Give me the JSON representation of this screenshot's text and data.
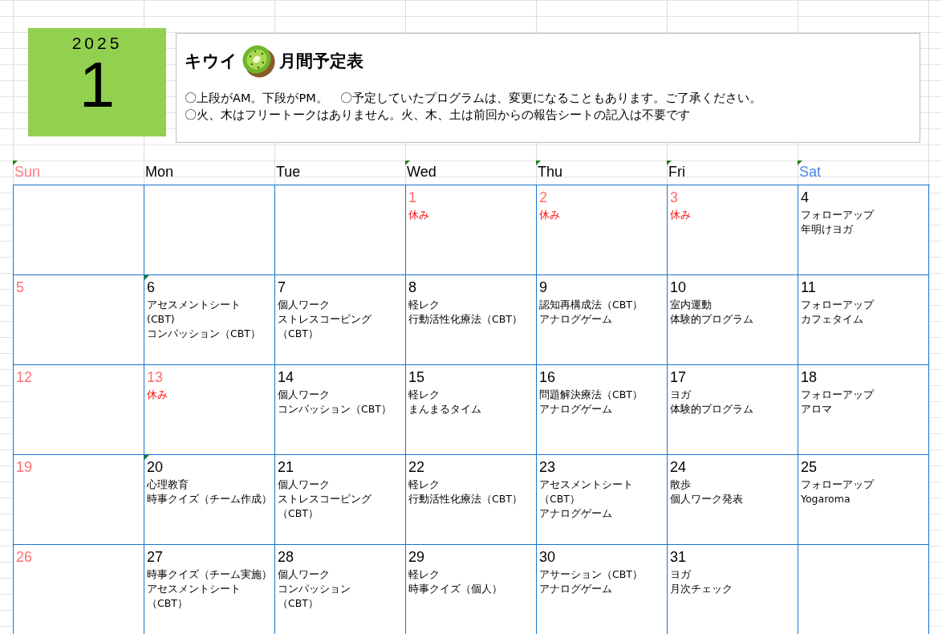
{
  "header": {
    "year": "2025",
    "month": "1",
    "title_before": "キウイ",
    "title_after": "月間予定表",
    "notes": [
      "〇上段がAM。下段がPM。　〇予定していたプログラムは、変更になることもあります。ご了承ください。",
      "〇火、木はフリートークはありません。火、木、土は前回からの報告シートの記入は不要です"
    ]
  },
  "weekdays": [
    {
      "label": "Sun",
      "color": "#ff7c80",
      "flagged": true
    },
    {
      "label": "Mon",
      "color": "#000000",
      "flagged": false
    },
    {
      "label": "Tue",
      "color": "#000000",
      "flagged": false
    },
    {
      "label": "Wed",
      "color": "#000000",
      "flagged": true
    },
    {
      "label": "Thu",
      "color": "#000000",
      "flagged": true
    },
    {
      "label": "Fri",
      "color": "#000000",
      "flagged": true
    },
    {
      "label": "Sat",
      "color": "#4a86e8",
      "flagged": true
    }
  ],
  "weeks": [
    [
      {
        "kind": "empty"
      },
      {
        "kind": "empty"
      },
      {
        "kind": "empty"
      },
      {
        "kind": "day",
        "day": "1",
        "holiday": true,
        "flagged": false,
        "lines": [
          "休み"
        ]
      },
      {
        "kind": "day",
        "day": "2",
        "holiday": true,
        "flagged": false,
        "lines": [
          "休み"
        ]
      },
      {
        "kind": "day",
        "day": "3",
        "holiday": true,
        "flagged": false,
        "lines": [
          "休み"
        ]
      },
      {
        "kind": "day",
        "day": "4",
        "holiday": false,
        "flagged": false,
        "lines": [
          "フォローアップ",
          "年明けヨガ"
        ]
      }
    ],
    [
      {
        "kind": "day",
        "day": "5",
        "holiday": true,
        "flagged": false
      },
      {
        "kind": "day",
        "day": "6",
        "holiday": false,
        "flagged": true,
        "lines": [
          "アセスメントシート",
          "(CBT)",
          "コンパッション（CBT）"
        ]
      },
      {
        "kind": "day",
        "day": "7",
        "holiday": false,
        "flagged": false,
        "lines": [
          "個人ワーク",
          "ストレスコーピング",
          "（CBT）"
        ]
      },
      {
        "kind": "day",
        "day": "8",
        "holiday": false,
        "flagged": false,
        "lines": [
          "軽レク",
          "行動活性化療法（CBT）"
        ]
      },
      {
        "kind": "day",
        "day": "9",
        "holiday": false,
        "flagged": false,
        "lines": [
          "認知再構成法（CBT）",
          "アナログゲーム"
        ]
      },
      {
        "kind": "day",
        "day": "10",
        "holiday": false,
        "flagged": false,
        "lines": [
          "室内運動",
          "体験的プログラム"
        ]
      },
      {
        "kind": "day",
        "day": "11",
        "holiday": false,
        "flagged": false,
        "lines": [
          "フォローアップ",
          "カフェタイム"
        ]
      }
    ],
    [
      {
        "kind": "day",
        "day": "12",
        "holiday": true,
        "flagged": false
      },
      {
        "kind": "day",
        "day": "13",
        "holiday": true,
        "flagged": false,
        "lines": [
          "休み"
        ]
      },
      {
        "kind": "day",
        "day": "14",
        "holiday": false,
        "flagged": false,
        "lines": [
          "個人ワーク",
          "コンパッション（CBT）"
        ]
      },
      {
        "kind": "day",
        "day": "15",
        "holiday": false,
        "flagged": false,
        "lines": [
          "軽レク",
          "まんまるタイム"
        ]
      },
      {
        "kind": "day",
        "day": "16",
        "holiday": false,
        "flagged": false,
        "lines": [
          "問題解決療法（CBT）",
          "アナログゲーム"
        ]
      },
      {
        "kind": "day",
        "day": "17",
        "holiday": false,
        "flagged": false,
        "lines": [
          "ヨガ",
          "体験的プログラム"
        ]
      },
      {
        "kind": "day",
        "day": "18",
        "holiday": false,
        "flagged": false,
        "lines": [
          "フォローアップ",
          "アロマ"
        ]
      }
    ],
    [
      {
        "kind": "day",
        "day": "19",
        "holiday": true,
        "flagged": false
      },
      {
        "kind": "day",
        "day": "20",
        "holiday": false,
        "flagged": true,
        "lines": [
          "心理教育",
          "時事クイズ（チーム作成）"
        ]
      },
      {
        "kind": "day",
        "day": "21",
        "holiday": false,
        "flagged": false,
        "lines": [
          "個人ワーク",
          "ストレスコーピング",
          "（CBT）"
        ]
      },
      {
        "kind": "day",
        "day": "22",
        "holiday": false,
        "flagged": false,
        "lines": [
          "軽レク",
          "行動活性化療法（CBT）"
        ]
      },
      {
        "kind": "day",
        "day": "23",
        "holiday": false,
        "flagged": false,
        "lines": [
          "アセスメントシート",
          "（CBT）",
          "アナログゲーム"
        ]
      },
      {
        "kind": "day",
        "day": "24",
        "holiday": false,
        "flagged": false,
        "lines": [
          "散歩",
          "個人ワーク発表"
        ]
      },
      {
        "kind": "day",
        "day": "25",
        "holiday": false,
        "flagged": false,
        "lines": [
          "フォローアップ",
          "Yogaroma"
        ]
      }
    ],
    [
      {
        "kind": "day",
        "day": "26",
        "holiday": true,
        "flagged": false
      },
      {
        "kind": "day",
        "day": "27",
        "holiday": false,
        "flagged": false,
        "lines": [
          "時事クイズ（チーム実施）",
          "アセスメントシート",
          "（CBT）"
        ]
      },
      {
        "kind": "day",
        "day": "28",
        "holiday": false,
        "flagged": false,
        "lines": [
          "個人ワーク",
          "コンパッション",
          "（CBT）"
        ]
      },
      {
        "kind": "day",
        "day": "29",
        "holiday": false,
        "flagged": false,
        "lines": [
          "軽レク",
          "時事クイズ（個人）"
        ]
      },
      {
        "kind": "day",
        "day": "30",
        "holiday": false,
        "flagged": false,
        "lines": [
          "アサーション（CBT）",
          "アナログゲーム"
        ]
      },
      {
        "kind": "day",
        "day": "31",
        "holiday": false,
        "flagged": false,
        "lines": [
          "ヨガ",
          "月次チェック"
        ]
      },
      {
        "kind": "empty"
      }
    ]
  ]
}
